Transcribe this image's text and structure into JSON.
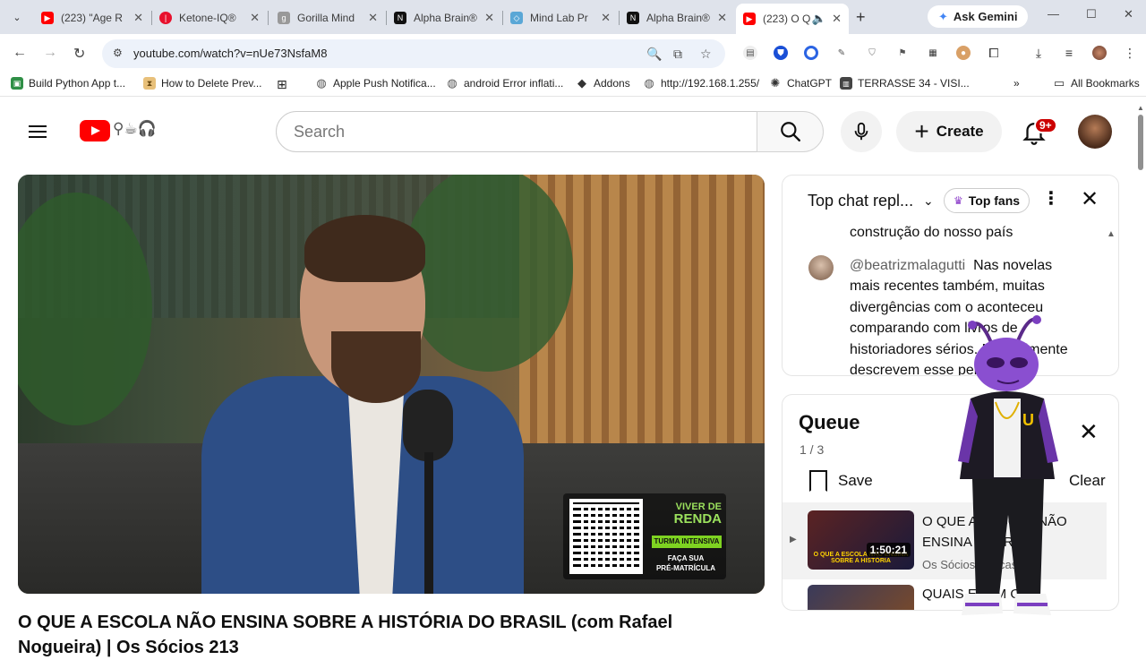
{
  "browser": {
    "tabs": [
      {
        "title": "(223) \"Age R",
        "favicon": "youtube-icon",
        "color": "#ff0000"
      },
      {
        "title": "Ketone-IQ®",
        "favicon": "ketone-icon",
        "color": "#e8112d"
      },
      {
        "title": "Gorilla Mind",
        "favicon": "gorilla-icon",
        "color": "#666666"
      },
      {
        "title": "Alpha Brain®",
        "favicon": "onnit-icon",
        "color": "#111111"
      },
      {
        "title": "Mind Lab Pr",
        "favicon": "mindlab-icon",
        "color": "#5aa7d6"
      },
      {
        "title": "Alpha Brain®",
        "favicon": "onnit-icon",
        "color": "#111111"
      },
      {
        "title": "(223) O Q",
        "favicon": "youtube-icon",
        "color": "#ff0000",
        "active": true
      }
    ],
    "gemini_label": "Ask Gemini",
    "url": "youtube.com/watch?v=nUe73NsfaM8",
    "bookmarks": [
      {
        "label": "Build Python App t...",
        "icon": "bookmark-green-icon"
      },
      {
        "label": "How to Delete Prev...",
        "icon": "bookmark-hourglass-icon"
      },
      {
        "label": "Apple Push Notifica...",
        "icon": "globe-icon"
      },
      {
        "label": "android Error inflati...",
        "icon": "globe-icon"
      },
      {
        "label": "Addons",
        "icon": "diamond-icon"
      },
      {
        "label": "http://192.168.1.255/",
        "icon": "globe-icon"
      },
      {
        "label": "ChatGPT",
        "icon": "chatgpt-icon"
      },
      {
        "label": "TERRASSE 34 - VISI...",
        "icon": "terrasse-icon"
      }
    ],
    "all_bookmarks_label": "All Bookmarks"
  },
  "youtube": {
    "search_placeholder": "Search",
    "create_label": "Create",
    "notification_badge": "9+",
    "video": {
      "title_line1": "O QUE A ESCOLA NÃO ENSINA SOBRE A HISTÓRIA DO BRASIL (com Rafael",
      "title_line2": "Nogueira) | Os Sócios 213",
      "promo": {
        "brand_line1": "VIVER DE",
        "brand_line2": "RENDA",
        "tag": "TURMA INTENSIVA",
        "cta_line1": "FAÇA SUA",
        "cta_line2": "PRÉ-MATRÍCULA"
      }
    },
    "chat": {
      "mode_label": "Top chat repl...",
      "top_fans_label": "Top fans",
      "messages": [
        {
          "line": "construção do nosso país"
        },
        {
          "author": "@beatrizmalagutti",
          "text_lines": [
            "Nas novelas",
            "mais recentes também, muitas",
            "divergências com o aconteceu",
            "comparando com livros de",
            "historiadores sérios. Normalmente",
            "descrevem esse per"
          ]
        }
      ]
    },
    "queue": {
      "title": "Queue",
      "count": "1 / 3",
      "save_label": "Save",
      "clear_label": "Clear",
      "items": [
        {
          "title": "O QUE A ESCOLA NÃO ENSINA SOBRE...",
          "channel": "Os Sócios Podcast",
          "duration": "1:50:21",
          "thumb_caption": "O QUE A ESCOLA NÃO ENSINA SOBRE A HISTÓRIA"
        },
        {
          "title": "QUAIS ERAM OS"
        }
      ]
    }
  }
}
